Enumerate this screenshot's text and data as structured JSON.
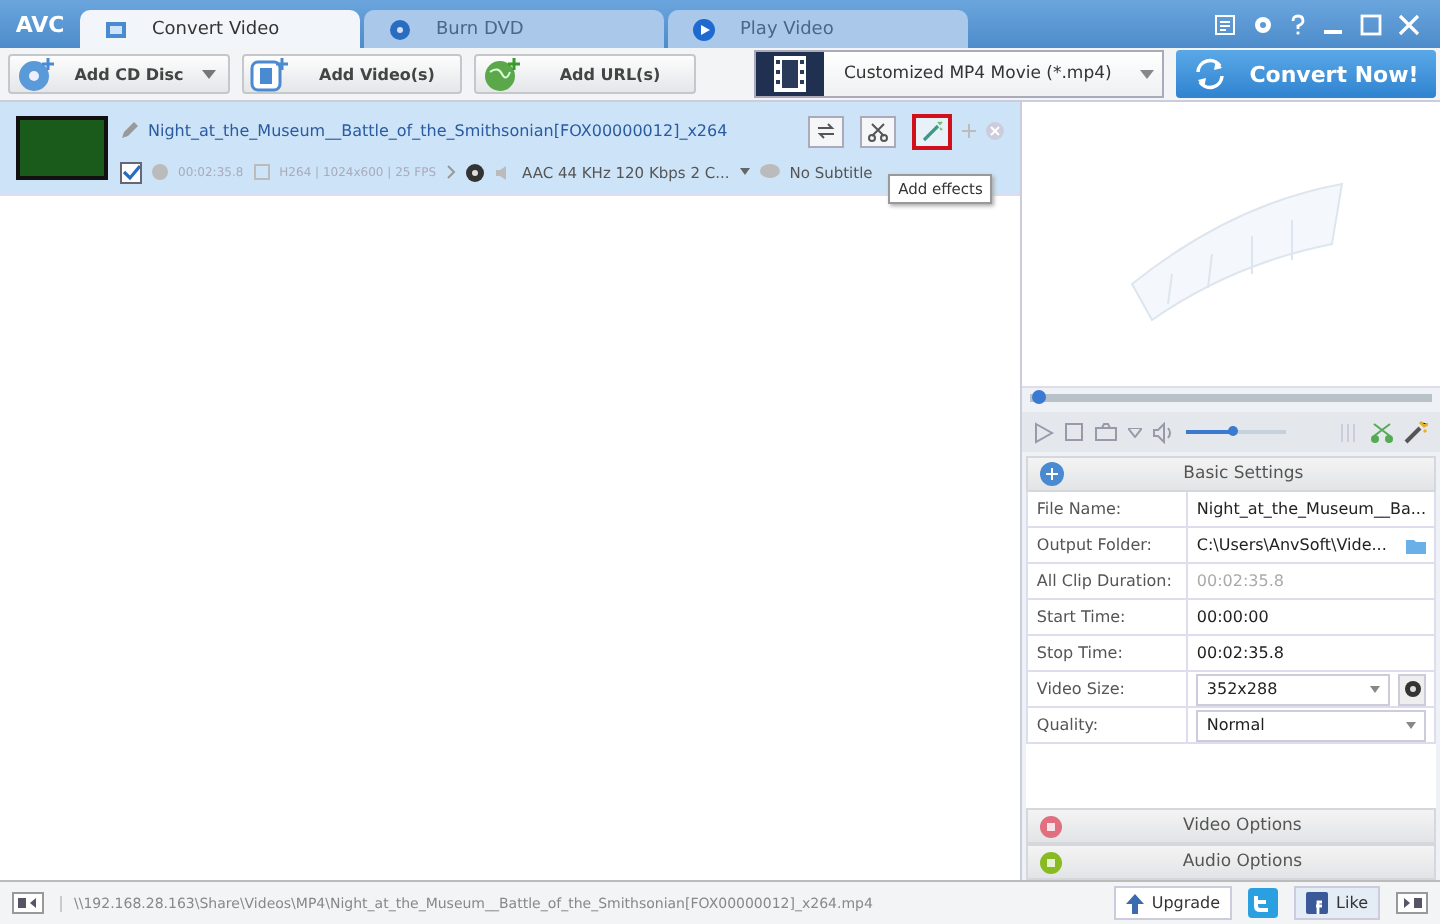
{
  "app_logo": "AVC",
  "tabs": [
    {
      "label": "Convert Video",
      "selected": true
    },
    {
      "label": "Burn DVD",
      "selected": false
    },
    {
      "label": "Play Video",
      "selected": false
    }
  ],
  "toolbar": {
    "buttons": [
      {
        "label": "Add CD Disc",
        "kind": "disc"
      },
      {
        "label": "Add Video(s)",
        "kind": "video"
      },
      {
        "label": "Add URL(s)",
        "kind": "url"
      }
    ],
    "profile": "Customized MP4 Movie (*.mp4)",
    "convert_button": "Convert Now!"
  },
  "file_list": [
    {
      "title": "Night_at_the_Museum__Battle_of_the_Smithsonian[FOX00000012]_x264",
      "checked": true,
      "selected": true,
      "duration": "00:02:35.8",
      "video_info": "H264 | 1024x600 | 25 FPS",
      "audio": "AAC 44 KHz 120 Kbps 2 C...",
      "subtitle": "No Subtitle"
    }
  ],
  "tooltip": "Add effects",
  "player": {
    "seek": {
      "level": 0.01
    },
    "volume": {
      "level": 0.45
    }
  },
  "basic_settings": {
    "title": "Basic Settings",
    "rows": [
      {
        "label": "File Name:",
        "value": "Night_at_the_Museum__Ba...",
        "kind": "text"
      },
      {
        "label": "Output Folder:",
        "value": "C:\\Users\\AnvSoft\\Vide...",
        "kind": "folder"
      },
      {
        "label": "All Clip Duration:",
        "value": "00:02:35.8",
        "kind": "dimmed"
      },
      {
        "label": "Start Time:",
        "value": "00:00:00",
        "kind": "text"
      },
      {
        "label": "Stop Time:",
        "value": "00:02:35.8",
        "kind": "text"
      },
      {
        "label": "Video Size:",
        "value": "352x288",
        "kind": "dropdown-gear"
      },
      {
        "label": "Quality:",
        "value": "Normal",
        "kind": "dropdown"
      }
    ]
  },
  "sections": [
    {
      "label": "Video Options",
      "color": "#e07080"
    },
    {
      "label": "Audio Options",
      "color": "#88bb22"
    }
  ],
  "status_bar": {
    "path": "\\\\192.168.28.163\\Share\\Videos\\MP4\\Night_at_the_Museum__Battle_of_the_Smithsonian[FOX00000012]_x264.mp4",
    "upgrade": "Upgrade",
    "like": "Like"
  }
}
